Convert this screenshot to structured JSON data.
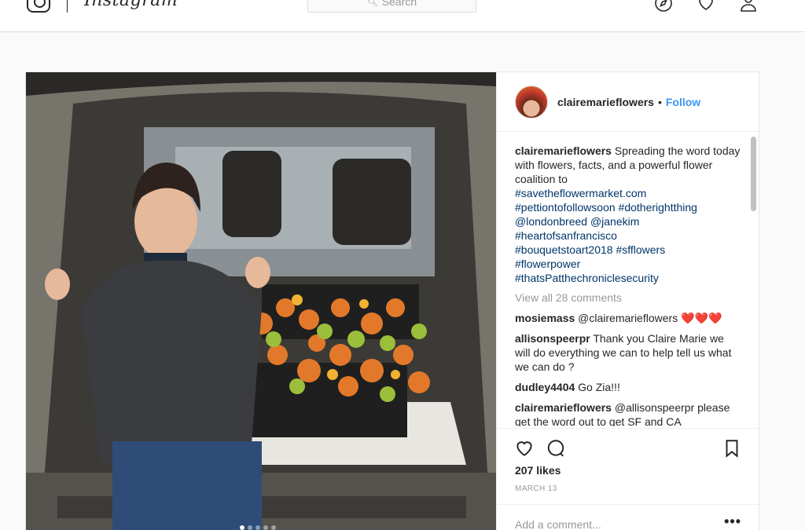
{
  "nav": {
    "logo_text": "Instagram",
    "search_placeholder": "Search",
    "icons": [
      "instagram-glyph-icon",
      "search-icon",
      "explore-compass-icon",
      "activity-heart-icon",
      "profile-person-icon"
    ]
  },
  "post": {
    "username": "clairemarieflowers",
    "follow_label": "Follow",
    "separator": "•",
    "caption": {
      "author": "clairemarieflowers",
      "text": "Spreading the word today with flowers, facts, and a powerful flower coalition to",
      "lines": [
        "#savetheflowermarket.com",
        "#pettiontofollowsoon #dotherightthing",
        "@londonbreed @janekim",
        "#heartofsanfrancisco",
        "#bouquetstoart2018 #sfflowers",
        "#flowerpower",
        "#thatsPatthechroniclesecurity"
      ],
      "link_tail": ".com"
    },
    "view_all_label": "View all 28 comments",
    "comments": [
      {
        "author": "mosiemass",
        "text": "@clairemarieflowers ❤️❤️❤️"
      },
      {
        "author": "allisonspeerpr",
        "text": "Thank you Claire Marie we will do everything we can to help tell us what we can do ?"
      },
      {
        "author": "dudley4404",
        "text": "Go Zia!!!"
      },
      {
        "author": "clairemarieflowers",
        "text": "@allisonspeerpr please get the word out to get SF and CA"
      }
    ],
    "likes": "207 likes",
    "date": "MARCH 13",
    "add_comment_placeholder": "Add a comment...",
    "more_label": "•••",
    "carousel_dots": 5,
    "carousel_active": 0
  },
  "colors": {
    "link_blue": "#3897f0",
    "hashtag": "#003569",
    "muted": "#999999",
    "text": "#262626"
  }
}
